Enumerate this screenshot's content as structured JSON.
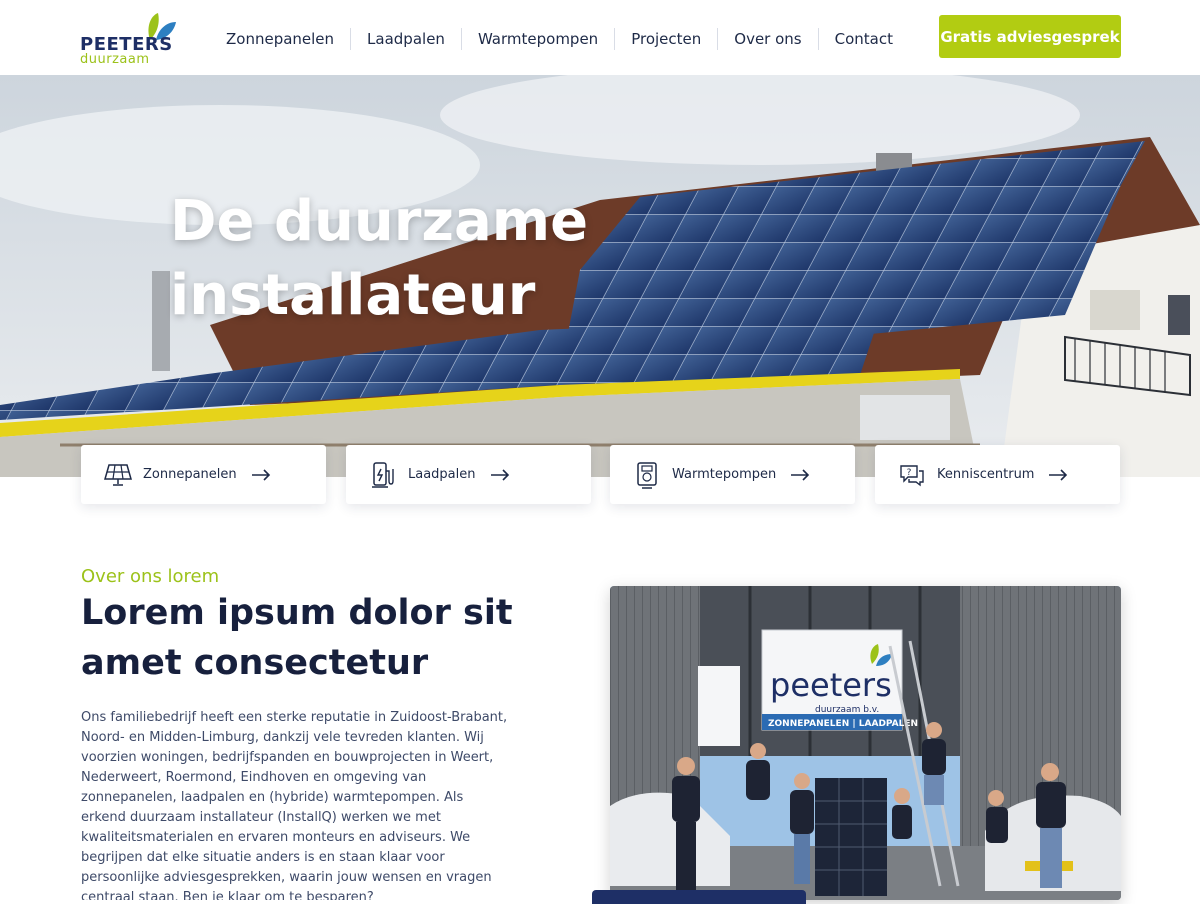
{
  "header": {
    "logo": {
      "main": "PEETERS",
      "sub": "duurzaam"
    },
    "nav": [
      "Zonnepanelen",
      "Laadpalen",
      "Warmtepompen",
      "Projecten",
      "Over ons",
      "Contact"
    ],
    "cta_label": "Gratis adviesgesprek"
  },
  "hero": {
    "title_line1": "De duurzame",
    "title_line2": "installateur"
  },
  "cards": [
    {
      "label": "Zonnepanelen",
      "icon": "solar-panel-icon"
    },
    {
      "label": "Laadpalen",
      "icon": "charging-station-icon"
    },
    {
      "label": "Warmtepompen",
      "icon": "heat-pump-icon"
    },
    {
      "label": "Kenniscentrum",
      "icon": "question-chat-icon"
    }
  ],
  "about": {
    "eyebrow": "Over ons lorem",
    "heading": "Lorem ipsum dolor sit amet consectetur",
    "body": "Ons familiebedrijf heeft een sterke reputatie in Zuidoost-Brabant, Noord- en Midden-Limburg, dankzij vele tevreden klanten. Wij voorzien woningen, bedrijfspanden en bouwprojecten in Weert, Nederweert, Roermond, Eindhoven en omgeving van zonnepanelen, laadpalen en (hybride) warmtepompen. Als erkend duurzaam installateur (InstallQ) werken we met kwaliteitsmaterialen en ervaren monteurs en adviseurs. We begrijpen dat elke situatie anders is en staan klaar voor persoonlijke adviesgesprekken, waarin jouw wensen en vragen centraal staan. Ben je klaar om te besparen?"
  },
  "photo": {
    "sign_brand": "peeters",
    "sign_sub": "duurzaam b.v.",
    "sign_strip": "ZONNEPANELEN | LAADPALEN"
  },
  "colors": {
    "accent_green": "#b2cc12",
    "navy": "#1e2f66",
    "text": "#1e2a47"
  }
}
